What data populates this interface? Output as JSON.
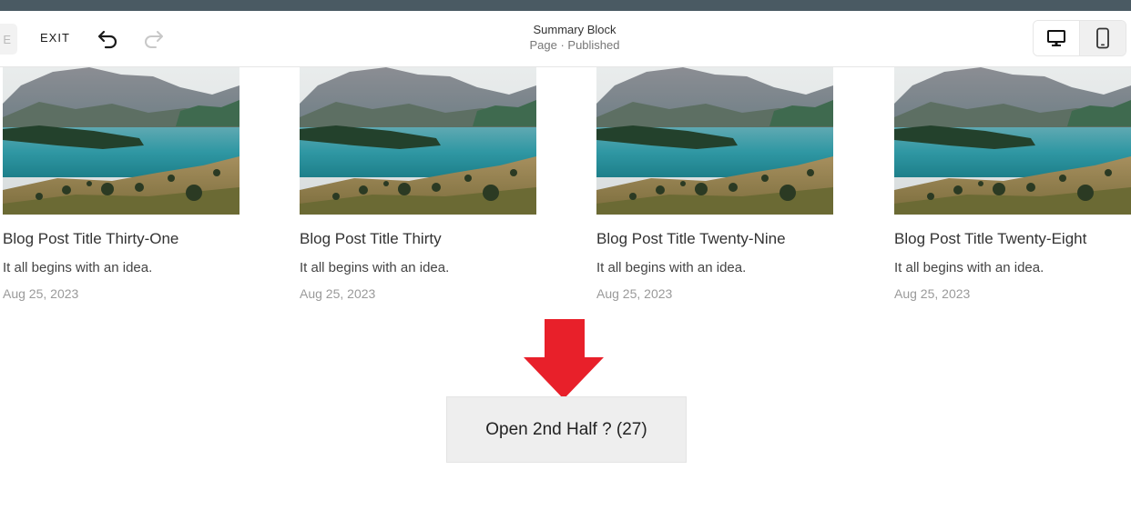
{
  "toolbar": {
    "save_label": "E",
    "exit_label": "EXIT",
    "undo_icon": "undo-icon",
    "redo_icon": "redo-icon",
    "page_title": "Summary Block",
    "page_status": "Page · Published",
    "desktop_icon": "desktop-icon",
    "mobile_icon": "mobile-icon"
  },
  "posts": [
    {
      "title": "Blog Post Title Thirty-One",
      "excerpt": "It all begins with an idea.",
      "date": "Aug 25, 2023"
    },
    {
      "title": "Blog Post Title Thirty",
      "excerpt": "It all begins with an idea.",
      "date": "Aug 25, 2023"
    },
    {
      "title": "Blog Post Title Twenty-Nine",
      "excerpt": "It all begins with an idea.",
      "date": "Aug 25, 2023"
    },
    {
      "title": "Blog Post Title Twenty-Eight",
      "excerpt": "It all begins with an idea.",
      "date": "Aug 25, 2023"
    }
  ],
  "load_more": {
    "label": "Open 2nd Half ? (27)"
  },
  "colors": {
    "arrow": "#e8202a",
    "top_strip": "#4a5a63"
  }
}
